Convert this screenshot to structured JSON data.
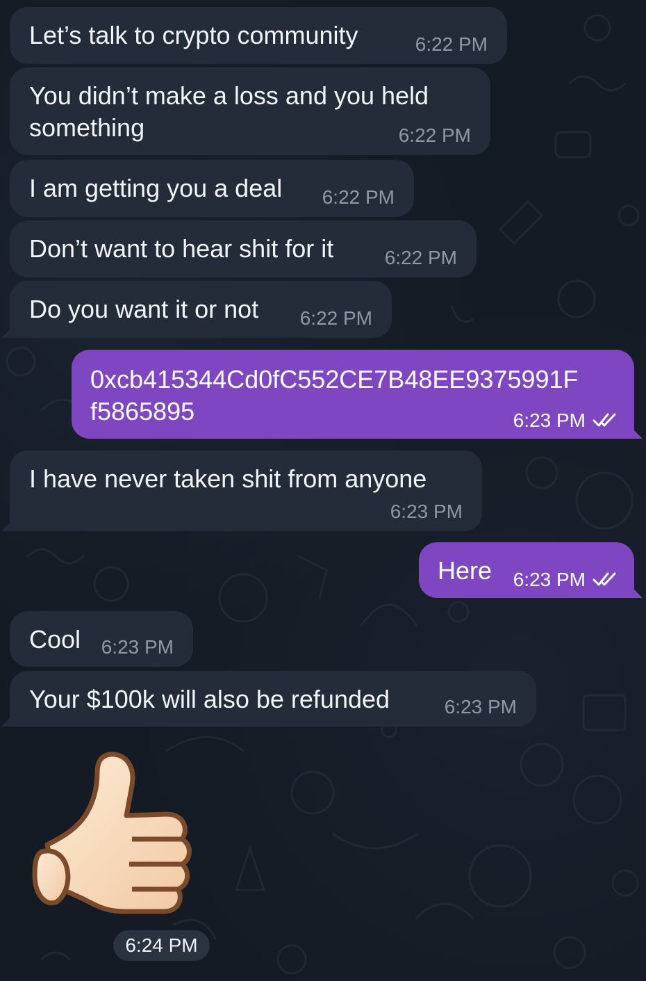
{
  "chat": {
    "messages": [
      {
        "direction": "in",
        "text": "Let’s talk to crypto community",
        "time": "6:22 PM"
      },
      {
        "direction": "in",
        "text": "You didn’t make a loss and you held\nsomething",
        "time": "6:22 PM"
      },
      {
        "direction": "in",
        "text": "I am getting you a deal",
        "time": "6:22 PM"
      },
      {
        "direction": "in",
        "text": "Don’t want to hear shit for it",
        "time": "6:22 PM"
      },
      {
        "direction": "in",
        "text": "Do you want it or not",
        "time": "6:22 PM"
      },
      {
        "direction": "out",
        "text": "0xcb415344Cd0fC552CE7B48EE9375991F\nf5865895",
        "time": "6:23 PM",
        "status": "read-double-check-icon"
      },
      {
        "direction": "in",
        "text": "I have never taken shit from anyone",
        "time": "6:23 PM"
      },
      {
        "direction": "out",
        "text": "Here",
        "time": "6:23 PM",
        "status": "read-double-check-icon"
      },
      {
        "direction": "in",
        "text": "Cool",
        "time": "6:23 PM"
      },
      {
        "direction": "in",
        "text": "Your $100k will also be refunded",
        "time": "6:23 PM"
      }
    ],
    "sticker": {
      "icon": "thumbs-up-icon",
      "time": "6:24 PM"
    }
  },
  "colors": {
    "background": "#151b24",
    "incoming_bubble": "#232c38",
    "outgoing_bubble": "#7e47c1",
    "incoming_time": "#8e99a8",
    "text": "#f2f4f7"
  }
}
